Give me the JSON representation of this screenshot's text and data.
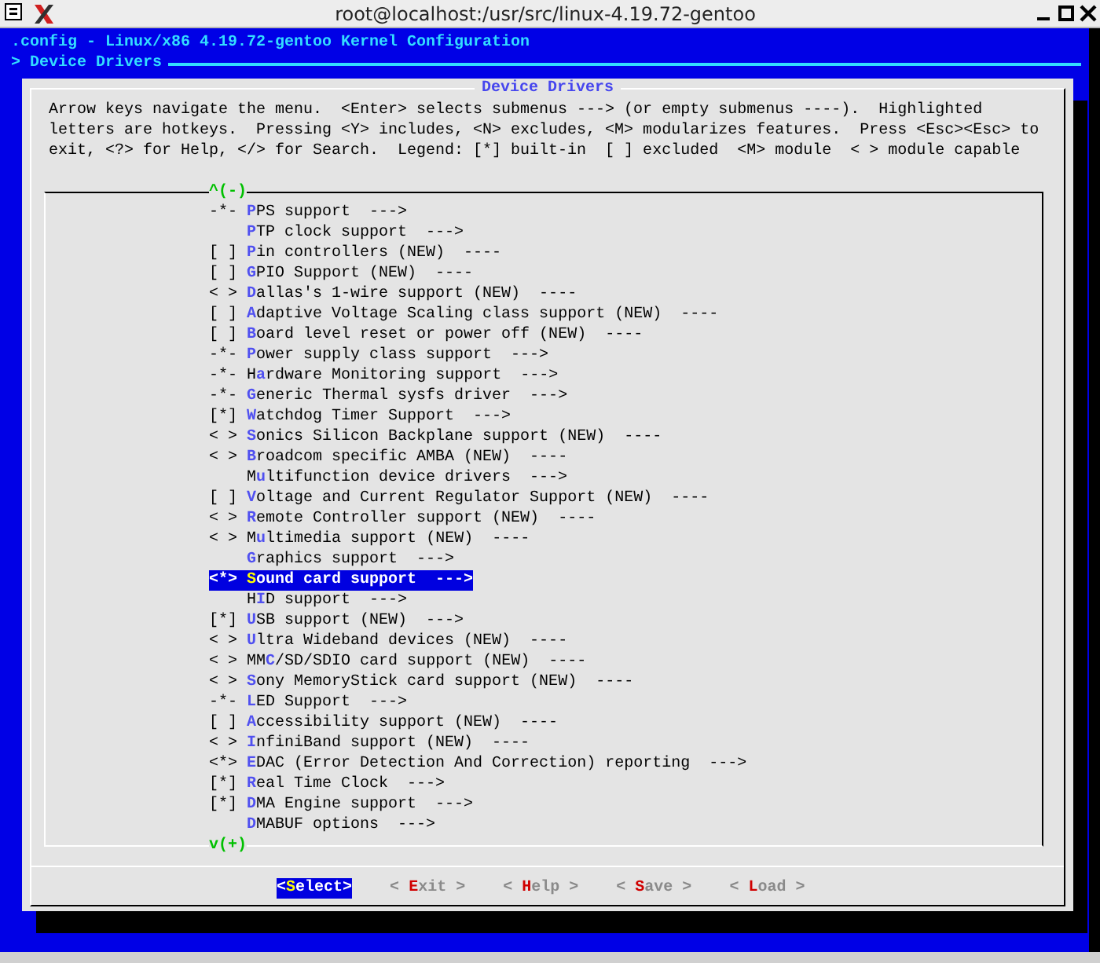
{
  "window": {
    "title": "root@localhost:/usr/src/linux-4.19.72-gentoo"
  },
  "header": {
    "title": ".config - Linux/x86 4.19.72-gentoo Kernel Configuration",
    "breadcrumb": "> Device Drivers"
  },
  "dialog": {
    "title": "Device Drivers",
    "help_lines": [
      "Arrow keys navigate the menu.  <Enter> selects submenus ---> (or empty submenus ----).  Highlighted",
      "letters are hotkeys.  Pressing <Y> includes, <N> excludes, <M> modularizes features.  Press <Esc><Esc> to",
      "exit, <?> for Help, </> for Search.  Legend: [*] built-in  [ ] excluded  <M> module  < > module capable"
    ],
    "scroll_up": "^(-)",
    "items": [
      {
        "status": "-*-",
        "label": "**P**PS support  --->",
        "selected": false
      },
      {
        "label": "**P**TP clock support  --->",
        "selected": false
      },
      {
        "status": "[ ]",
        "label": "**P**in controllers (NEW)  ----",
        "selected": false
      },
      {
        "status": "[ ]",
        "label": "**G**PIO Support (NEW)  ----",
        "selected": false
      },
      {
        "status": "< >",
        "label": "**D**allas's 1-wire support (NEW)  ----",
        "selected": false
      },
      {
        "status": "[ ]",
        "label": "**A**daptive Voltage Scaling class support (NEW)  ----",
        "selected": false
      },
      {
        "status": "[ ]",
        "label": "**B**oard level reset or power off (NEW)  ----",
        "selected": false
      },
      {
        "status": "-*-",
        "label": "**P**ower supply class support  --->",
        "selected": false
      },
      {
        "status": "-*-",
        "label": "H**a**rdware Monitoring support  --->",
        "selected": false
      },
      {
        "status": "-*-",
        "label": "**G**eneric Thermal sysfs driver  --->",
        "selected": false
      },
      {
        "status": "[*]",
        "label": "**W**atchdog Timer Support  --->",
        "selected": false
      },
      {
        "status": "< >",
        "label": "**S**onics Silicon Backplane support (NEW)  ----",
        "selected": false
      },
      {
        "status": "< >",
        "label": "**B**roadcom specific AMBA (NEW)  ----",
        "selected": false
      },
      {
        "label": "M**u**ltifunction device drivers  --->",
        "selected": false
      },
      {
        "status": "[ ]",
        "label": "**V**oltage and Current Regulator Support (NEW)  ----",
        "selected": false
      },
      {
        "status": "< >",
        "label": "**R**emote Controller support (NEW)  ----",
        "selected": false
      },
      {
        "status": "< >",
        "label": "M**u**ltimedia support (NEW)  ----",
        "selected": false
      },
      {
        "label": "**G**raphics support  --->",
        "selected": false
      },
      {
        "status": "<*>",
        "label": "**S**ound card support  --->",
        "selected": true
      },
      {
        "label": "H**I**D support  --->",
        "selected": false
      },
      {
        "status": "[*]",
        "label": "**U**SB support (NEW)  --->",
        "selected": false
      },
      {
        "status": "< >",
        "label": "**U**ltra Wideband devices (NEW)  ----",
        "selected": false
      },
      {
        "status": "< >",
        "label": "MM**C**/SD/SDIO card support (NEW)  ----",
        "selected": false
      },
      {
        "status": "< >",
        "label": "**S**ony MemoryStick card support (NEW)  ----",
        "selected": false
      },
      {
        "status": "-*-",
        "label": "**L**ED Support  --->",
        "selected": false
      },
      {
        "status": "[ ]",
        "label": "**A**ccessibility support (NEW)  ----",
        "selected": false
      },
      {
        "status": "< >",
        "label": "**I**nfiniBand support (NEW)  ----",
        "selected": false
      },
      {
        "status": "<*>",
        "label": "**E**DAC (Error Detection And Correction) reporting  --->",
        "selected": false
      },
      {
        "status": "[*]",
        "label": "**R**eal Time Clock  --->",
        "selected": false
      },
      {
        "status": "[*]",
        "label": "**D**MA Engine support  --->",
        "selected": false
      },
      {
        "label": "**D**MABUF options  --->",
        "selected": false
      }
    ],
    "scroll_down": "v(+)",
    "buttons": [
      {
        "label": "<**S**elect>",
        "selected": true
      },
      {
        "label": "< **E**xit >",
        "selected": false
      },
      {
        "label": "< **H**elp >",
        "selected": false
      },
      {
        "label": "< **S**ave >",
        "selected": false
      },
      {
        "label": "< **L**oad >",
        "selected": false
      }
    ]
  }
}
